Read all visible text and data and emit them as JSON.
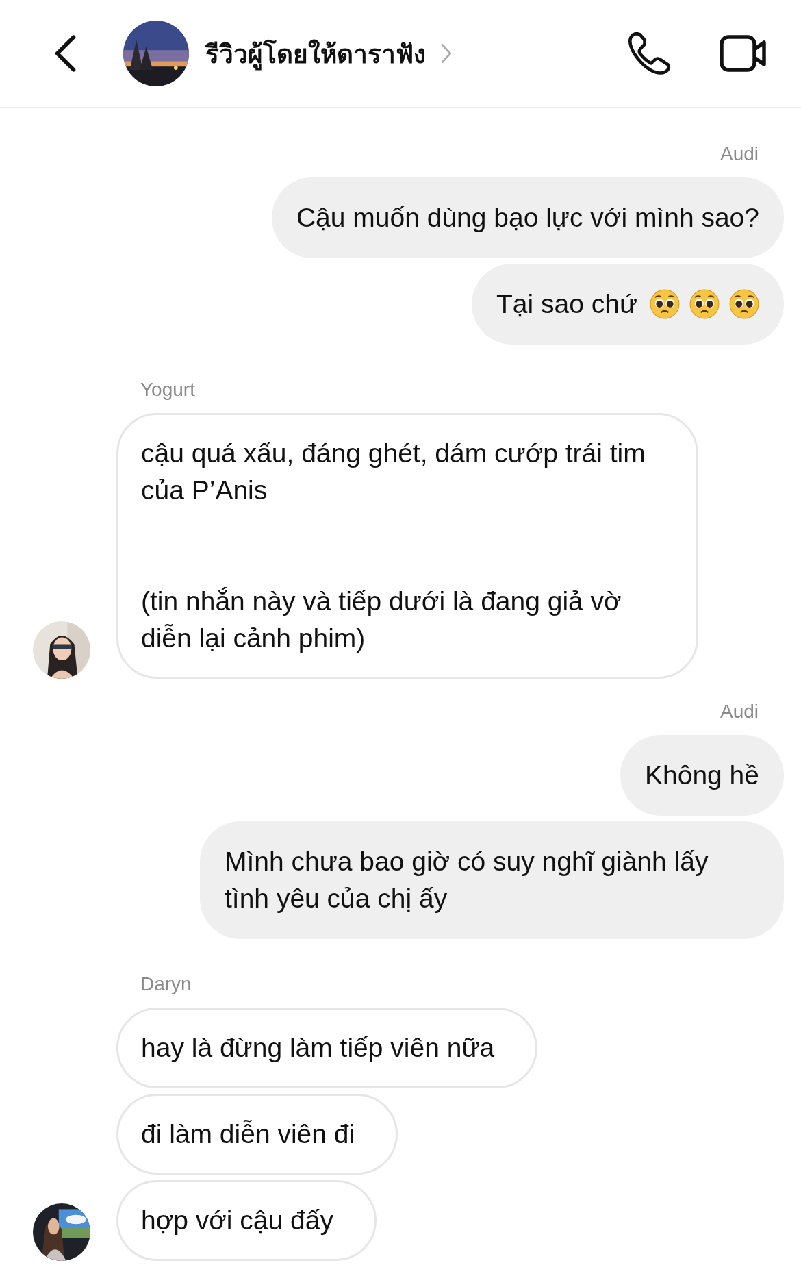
{
  "header": {
    "title": "รีวิวผู้โดยให้ดาราฟัง",
    "avatar": {
      "kind": "picture"
    }
  },
  "groups": [
    {
      "kind": "outgoing",
      "sender": "Audi",
      "messages": [
        {
          "text": "Cậu muốn dùng bạo lực với mình sao?"
        },
        {
          "text": "Tại sao chứ",
          "emojis": [
            {
              "kind": "pleading"
            },
            {
              "kind": "pleading"
            },
            {
              "kind": "pleading"
            }
          ]
        }
      ]
    },
    {
      "kind": "incoming",
      "sender": "Yogurt",
      "avatar": {
        "kind": "picture"
      },
      "messages": [
        {
          "text": "cậu quá xấu, đáng ghét, dám cướp trái tim của P’Anis\n\n\n(tin nhắn này và tiếp dưới là đang giả vờ diễn lại cảnh phim)"
        }
      ]
    },
    {
      "kind": "outgoing",
      "sender": "Audi",
      "messages": [
        {
          "text": "Không hề"
        },
        {
          "text": "Mình chưa bao giờ có suy nghĩ giành lấy tình yêu của chị ấy"
        }
      ]
    },
    {
      "kind": "incoming",
      "sender": "Daryn",
      "avatar": {
        "kind": "picture"
      },
      "messages": [
        {
          "text": "hay là đừng làm tiếp viên nữa"
        },
        {
          "text": "đi làm diễn viên đi"
        },
        {
          "text": "hợp với cậu đấy"
        }
      ]
    }
  ]
}
